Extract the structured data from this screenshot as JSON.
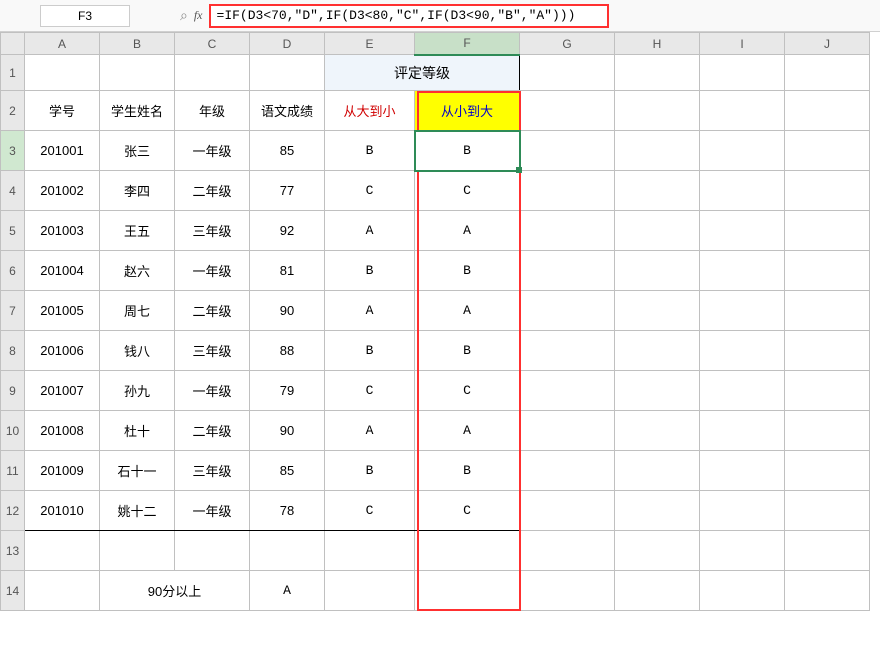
{
  "nameBox": "F3",
  "fxLabel": "fx",
  "formula": "=IF(D3<70,\"D\",IF(D3<80,\"C\",IF(D3<90,\"B\",\"A\")))",
  "cols": [
    "A",
    "B",
    "C",
    "D",
    "E",
    "F",
    "G",
    "H",
    "I",
    "J"
  ],
  "rows": [
    "1",
    "2",
    "3",
    "4",
    "5",
    "6",
    "7",
    "8",
    "9",
    "10",
    "11",
    "12",
    "13",
    "14"
  ],
  "mergeHeader": "评定等级",
  "headers": {
    "a": "学号",
    "b": "学生姓名",
    "c": "年级",
    "d": "语文成绩",
    "e": "从大到小",
    "f": "从小到大"
  },
  "data": [
    {
      "id": "201001",
      "name": "张三",
      "grade": "一年级",
      "score": "85",
      "e": "B",
      "f": "B"
    },
    {
      "id": "201002",
      "name": "李四",
      "grade": "二年级",
      "score": "77",
      "e": "C",
      "f": "C"
    },
    {
      "id": "201003",
      "name": "王五",
      "grade": "三年级",
      "score": "92",
      "e": "A",
      "f": "A"
    },
    {
      "id": "201004",
      "name": "赵六",
      "grade": "一年级",
      "score": "81",
      "e": "B",
      "f": "B"
    },
    {
      "id": "201005",
      "name": "周七",
      "grade": "二年级",
      "score": "90",
      "e": "A",
      "f": "A"
    },
    {
      "id": "201006",
      "name": "钱八",
      "grade": "三年级",
      "score": "88",
      "e": "B",
      "f": "B"
    },
    {
      "id": "201007",
      "name": "孙九",
      "grade": "一年级",
      "score": "79",
      "e": "C",
      "f": "C"
    },
    {
      "id": "201008",
      "name": "杜十",
      "grade": "二年级",
      "score": "90",
      "e": "A",
      "f": "A"
    },
    {
      "id": "201009",
      "name": "石十一",
      "grade": "三年级",
      "score": "85",
      "e": "B",
      "f": "B"
    },
    {
      "id": "201010",
      "name": "姚十二",
      "grade": "一年级",
      "score": "78",
      "e": "C",
      "f": "C"
    }
  ],
  "footer": {
    "label": "90分以上",
    "val": "A"
  }
}
